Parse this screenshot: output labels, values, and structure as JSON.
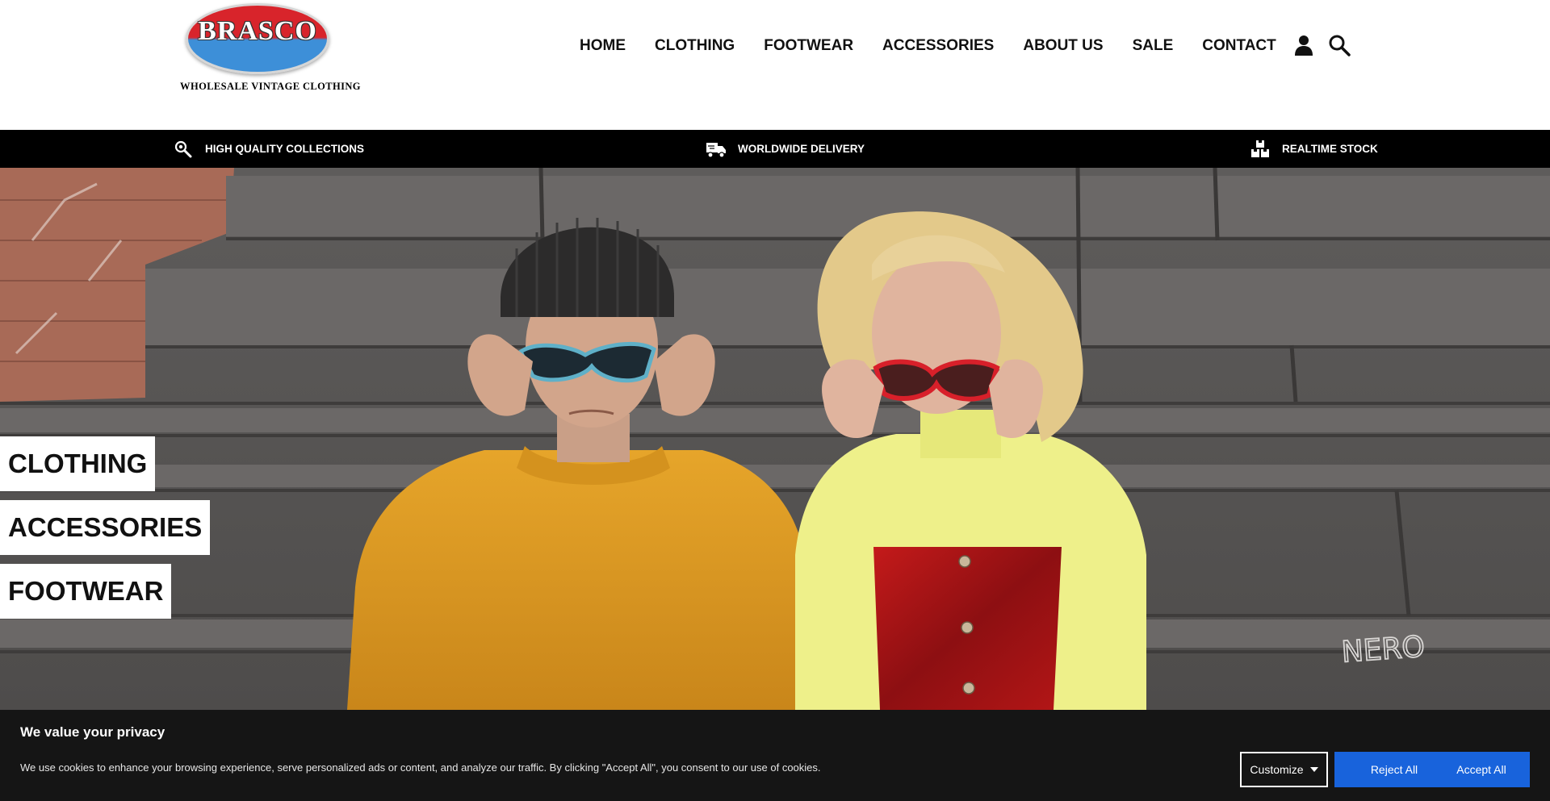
{
  "brand": {
    "name": "BRASCO",
    "tagline": "WHOLESALE VINTAGE CLOTHING"
  },
  "nav": {
    "items": [
      "HOME",
      "CLOTHING",
      "FOOTWEAR",
      "ACCESSORIES",
      "ABOUT US",
      "SALE",
      "CONTACT"
    ],
    "icons": [
      "account-icon",
      "search-icon"
    ]
  },
  "features": [
    {
      "icon": "magnifier-icon",
      "label": "HIGH QUALITY COLLECTIONS"
    },
    {
      "icon": "delivery-truck-icon",
      "label": "WORLDWIDE DELIVERY"
    },
    {
      "icon": "stock-boxes-icon",
      "label": "REALTIME STOCK"
    }
  ],
  "hero": {
    "categories": [
      "CLOTHING",
      "ACCESSORIES",
      "FOOTWEAR"
    ],
    "wall_text": "NERO"
  },
  "cookie": {
    "title": "We value your privacy",
    "description": "We use cookies to enhance your browsing experience, serve personalized ads or content, and analyze our traffic. By clicking \"Accept All\", you consent to our use of cookies.",
    "customize_label": "Customize",
    "reject_label": "Reject All",
    "accept_label": "Accept All"
  },
  "colors": {
    "accent_blue": "#1863dc",
    "banner_bg": "#151515",
    "bar_bg": "#000000"
  }
}
